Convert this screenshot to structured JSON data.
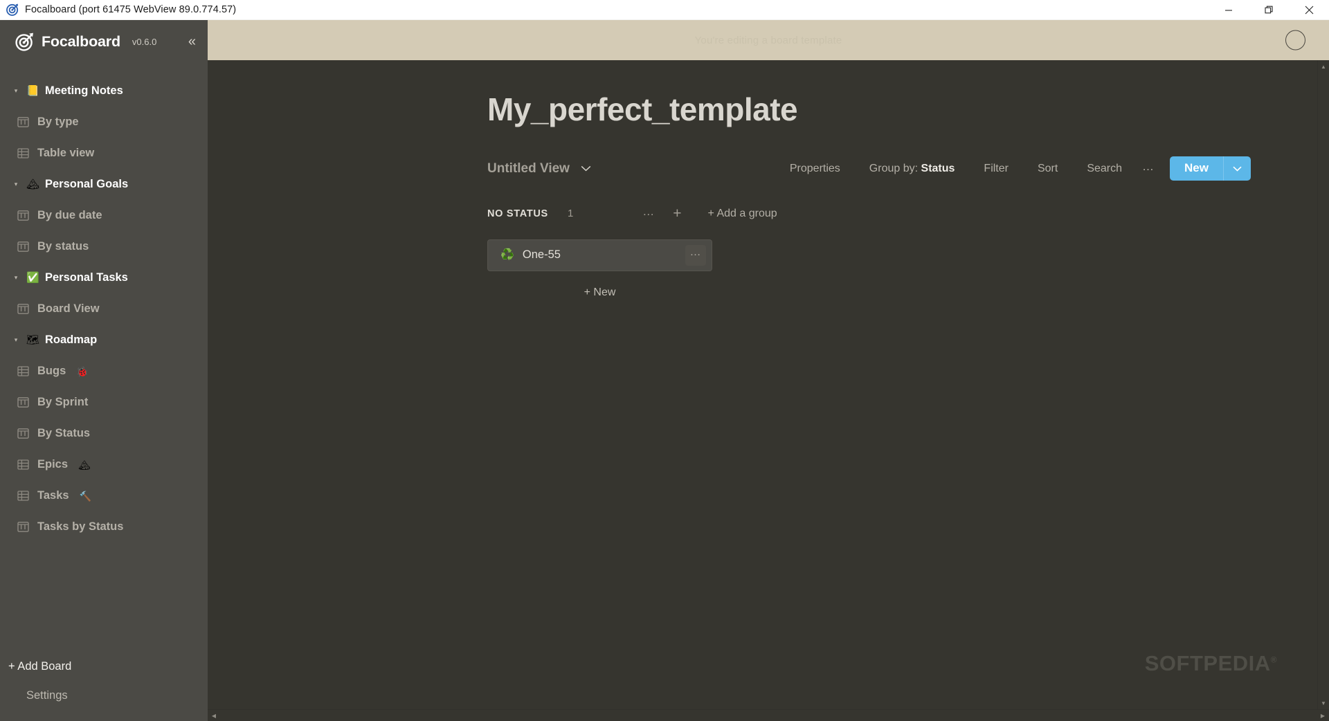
{
  "window": {
    "title": "Focalboard (port 61475 WebView 89.0.774.57)",
    "app_icon": "focalboard-target-icon",
    "controls": {
      "minimize": "minimize-icon",
      "maximize": "restore-icon",
      "close": "close-icon"
    }
  },
  "sidebar": {
    "brand": "Focalboard",
    "version": "v0.6.0",
    "collapse_icon": "«",
    "boards": [
      {
        "name": "Meeting Notes",
        "emoji": "📒",
        "caret": "▾",
        "views": [
          {
            "label": "By type",
            "icon": "board-view-icon",
            "emoji": ""
          },
          {
            "label": "Table view",
            "icon": "table-view-icon",
            "emoji": ""
          }
        ]
      },
      {
        "name": "Personal Goals",
        "emoji": "🏔",
        "caret": "▾",
        "views": [
          {
            "label": "By due date",
            "icon": "board-view-icon",
            "emoji": ""
          },
          {
            "label": "By status",
            "icon": "board-view-icon",
            "emoji": ""
          }
        ]
      },
      {
        "name": "Personal Tasks",
        "emoji": "✅",
        "caret": "▾",
        "views": [
          {
            "label": "Board View",
            "icon": "board-view-icon",
            "emoji": ""
          }
        ]
      },
      {
        "name": "Roadmap",
        "emoji": "🗺",
        "caret": "▾",
        "views": [
          {
            "label": "Bugs",
            "icon": "table-view-icon",
            "emoji": "🐞"
          },
          {
            "label": "By Sprint",
            "icon": "board-view-icon",
            "emoji": ""
          },
          {
            "label": "By Status",
            "icon": "board-view-icon",
            "emoji": ""
          },
          {
            "label": "Epics",
            "icon": "table-view-icon",
            "emoji": "🏔"
          },
          {
            "label": "Tasks",
            "icon": "table-view-icon",
            "emoji": "🔨"
          },
          {
            "label": "Tasks by Status",
            "icon": "board-view-icon",
            "emoji": ""
          }
        ]
      }
    ],
    "add_board": "+ Add Board",
    "settings": "Settings"
  },
  "banner": {
    "text": "You're editing a board template",
    "avatar": "user-avatar"
  },
  "board": {
    "title": "My_perfect_template",
    "view_name": "Untitled View",
    "view_caret_icon": "chevron-down-icon",
    "toolbar": {
      "properties": "Properties",
      "group_by_prefix": "Group by:",
      "group_by_value": "Status",
      "filter": "Filter",
      "sort": "Sort",
      "search": "Search",
      "more": "…",
      "new": "New",
      "new_caret_icon": "chevron-down-icon",
      "accent_color": "#5cb7e8"
    },
    "groups": [
      {
        "title": "NO STATUS",
        "count": "1",
        "menu": "…",
        "add": "+",
        "cards": [
          {
            "emoji": "♻️",
            "title": "One-55",
            "menu": "…"
          }
        ],
        "new_card": "+ New"
      }
    ],
    "add_group": "+ Add a group"
  },
  "watermark": {
    "text": "SOFTPEDIA",
    "mark": "®"
  }
}
